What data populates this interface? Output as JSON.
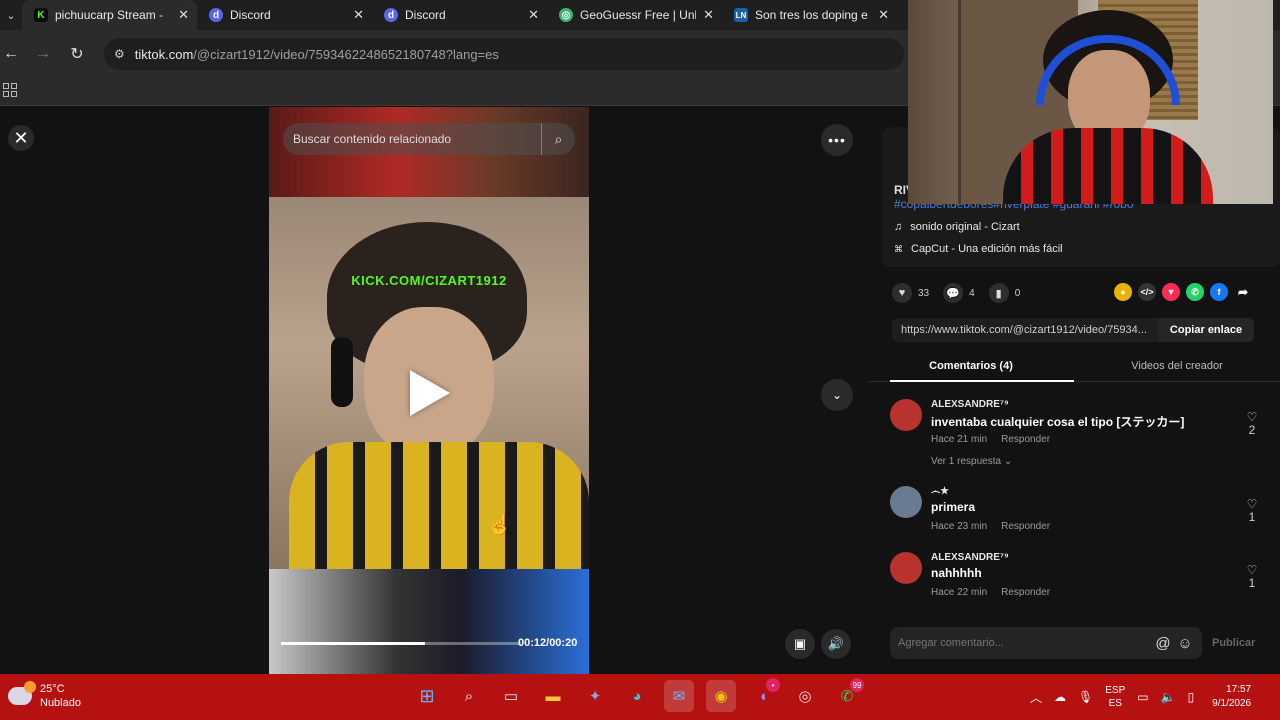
{
  "browser": {
    "tabs": [
      {
        "title": "pichuucarp Stream -",
        "icon": "kick-icon",
        "color": "#53fc18"
      },
      {
        "title": "Discord",
        "icon": "discord-icon",
        "color": "#5865f2"
      },
      {
        "title": "Discord",
        "icon": "discord-icon",
        "color": "#5865f2"
      },
      {
        "title": "GeoGuessr Free | Unl",
        "icon": "geoguessr-icon",
        "color": "#3bb26f"
      },
      {
        "title": "Son tres los doping e",
        "icon": "news-icon",
        "color": "#1f5fa8"
      }
    ],
    "url_host": "tiktok.com",
    "url_path": "/@cizart1912/video/7593462248652180748?lang=es"
  },
  "video": {
    "search_placeholder": "Buscar contenido relacionado",
    "overlay_text": "KICK.COM/CIZART1912",
    "time": "00:12/00:20",
    "progress": 0.6
  },
  "panel": {
    "author_partial": "RIV",
    "hashtags": "#copalbertdebores#riverplate #guarani #robo",
    "sound": "sonido original - Cizart",
    "capcut": "CapCut - Una edición más fácil",
    "likes": "33",
    "comments_count": "4",
    "saves": "0",
    "link": "https://www.tiktok.com/@cizart1912/video/75934...",
    "copy_label": "Copiar enlace",
    "tab_comments": "Comentarios (4)",
    "tab_creator": "Videos del creador",
    "comments": [
      {
        "user": "ALEXSANDRE⁷⁹",
        "text": "inventaba cualquier cosa el tipo [ステッカー]",
        "time": "Hace 21 min",
        "reply": "Responder",
        "likes": "2",
        "replies": "Ver 1 respuesta",
        "avatar_color": "#b8322e"
      },
      {
        "user": "෴★",
        "text": "primera",
        "time": "Hace 23 min",
        "reply": "Responder",
        "likes": "1",
        "avatar_color": "#6a7a90"
      },
      {
        "user": "ALEXSANDRE⁷⁹",
        "text": "nahhhhh",
        "time": "Hace 22 min",
        "reply": "Responder",
        "likes": "1",
        "avatar_color": "#b8322e"
      }
    ],
    "comment_placeholder": "Agregar comentario...",
    "post_label": "Publicar"
  },
  "taskbar": {
    "temp": "25°C",
    "weather": "Nublado",
    "lang1": "ESP",
    "lang2": "ES",
    "time": "17:57",
    "date": "9/1/2026",
    "whatsapp_badge": "99"
  }
}
